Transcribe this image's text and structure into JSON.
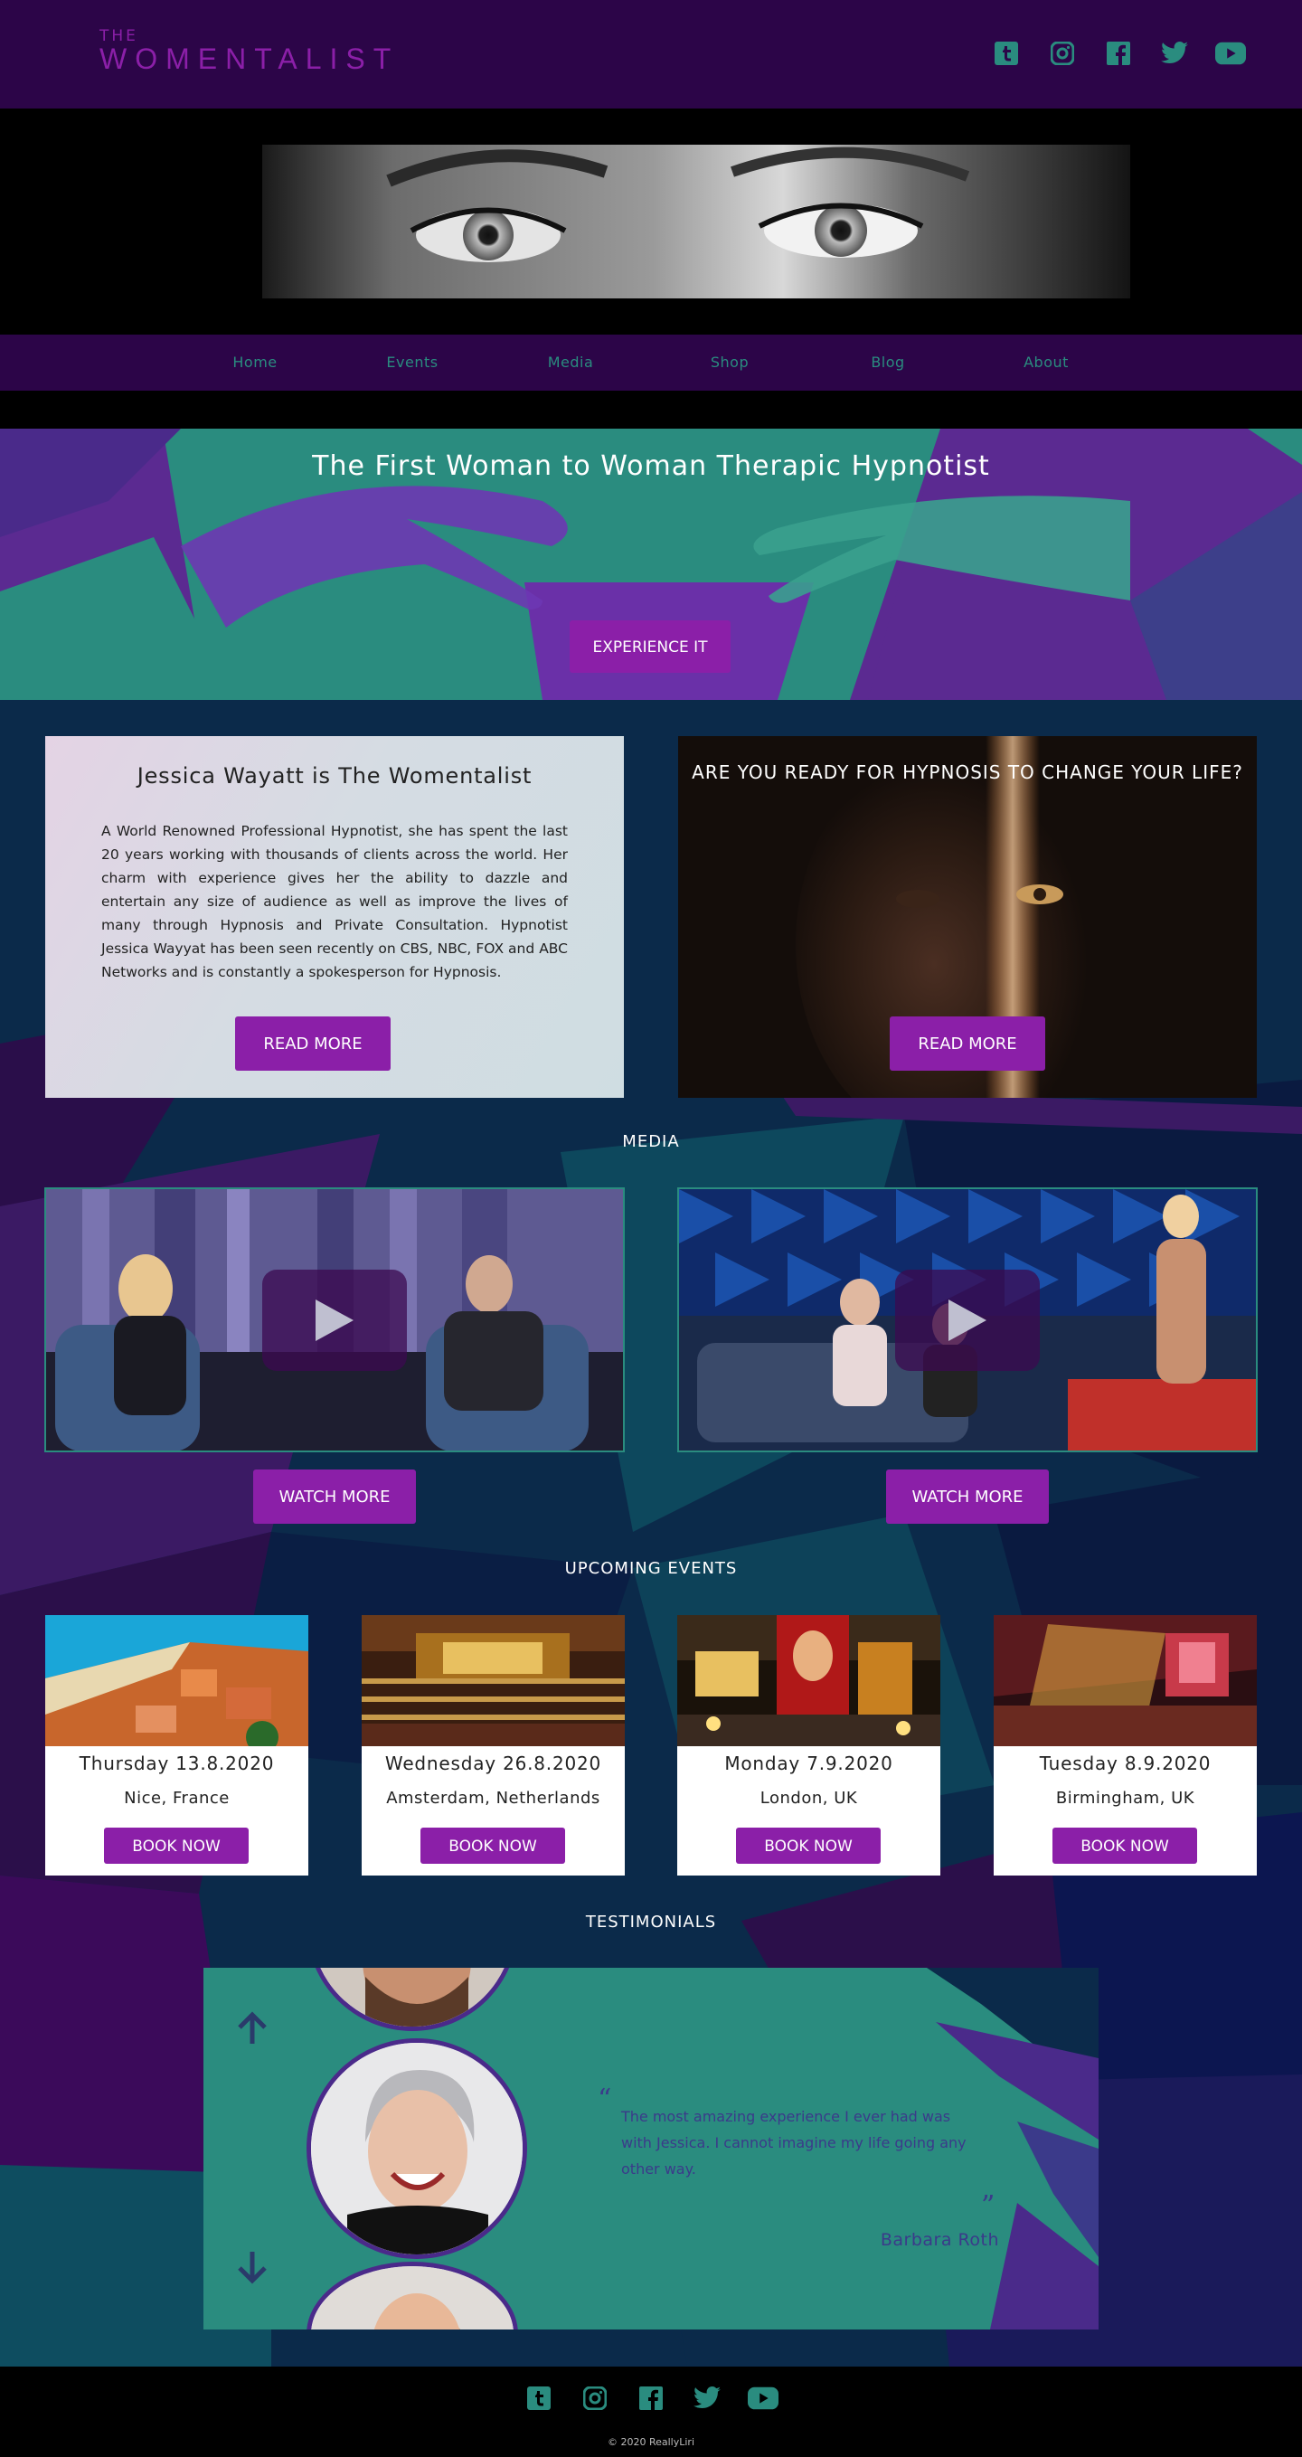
{
  "header": {
    "logo_small": "THE",
    "logo_main": "WOMENTALIST",
    "social": [
      "tumblr-icon",
      "instagram-icon",
      "facebook-icon",
      "twitter-icon",
      "youtube-icon"
    ]
  },
  "nav": [
    "Home",
    "Events",
    "Media",
    "Shop",
    "Blog",
    "About"
  ],
  "banner": {
    "title": "The First Woman to Woman Therapic Hypnotist",
    "cta": "EXPERIENCE IT"
  },
  "about": {
    "heading": "Jessica Wayatt is The Womentalist",
    "body": "A World Renowned Professional Hypnotist, she has spent the last 20 years working with thousands of clients across the world. Her charm with experience gives her the ability to dazzle and entertain any size of audience as well as improve the lives of many through Hypnosis and Private Consultation. Hypnotist Jessica Wayyat has been seen recently on CBS, NBC, FOX and ABC Networks and is constantly a spokesperson for Hypnosis.",
    "cta": "READ MORE"
  },
  "ready": {
    "heading": "ARE YOU READY FOR HYPNOSIS TO CHANGE YOUR LIFE?",
    "cta": "READ MORE"
  },
  "media": {
    "title": "MEDIA",
    "videos": [
      {
        "cta": "WATCH MORE"
      },
      {
        "cta": "WATCH MORE"
      }
    ]
  },
  "events": {
    "title": "UPCOMING EVENTS",
    "items": [
      {
        "date": "Thursday 13.8.2020",
        "location": "Nice, France",
        "cta": "BOOK NOW"
      },
      {
        "date": "Wednesday 26.8.2020",
        "location": "Amsterdam, Netherlands",
        "cta": "BOOK NOW"
      },
      {
        "date": "Monday 7.9.2020",
        "location": "London, UK",
        "cta": "BOOK NOW"
      },
      {
        "date": "Tuesday 8.9.2020",
        "location": "Birmingham, UK",
        "cta": "BOOK NOW"
      }
    ]
  },
  "testimonials": {
    "title": "TESTIMONIALS",
    "quote": "The most amazing experience I ever had was with Jessica. I cannot imagine my life going any other way.",
    "author": "Barbara Roth",
    "open_mark": "“",
    "close_mark": "”"
  },
  "footer": {
    "copyright": "© 2020 ReallyLiri"
  },
  "colors": {
    "header_bg": "#2c0548",
    "accent_purple": "#8b1fa8",
    "teal": "#2a8c7f",
    "dark_blue": "#0b2a4a"
  }
}
